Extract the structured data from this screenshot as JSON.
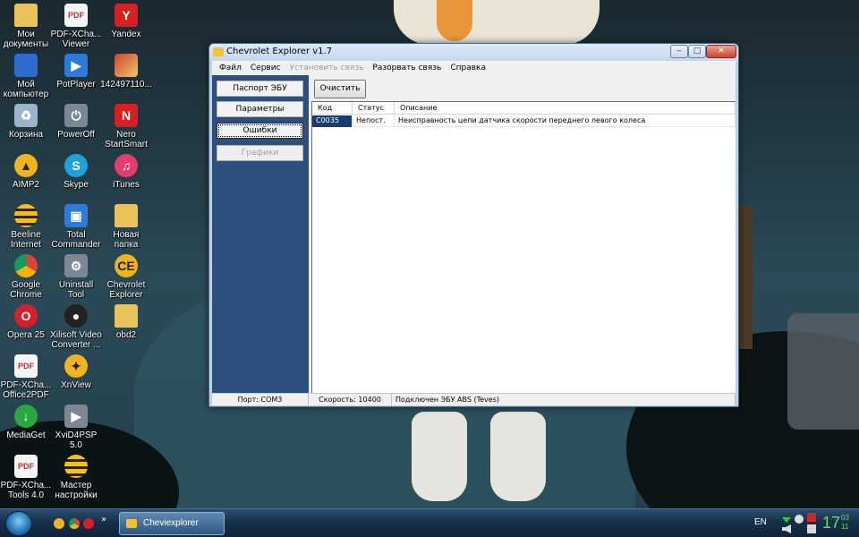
{
  "desktop": {
    "icons": [
      {
        "label": "Мои документы",
        "icon": "folder-icon"
      },
      {
        "label": "Мой компьютер",
        "icon": "computer-icon"
      },
      {
        "label": "Корзина",
        "icon": "recycle-bin-icon"
      },
      {
        "label": "AIMP2",
        "icon": "aimp-icon"
      },
      {
        "label": "Beeline Internet",
        "icon": "beeline-icon"
      },
      {
        "label": "Google Chrome",
        "icon": "chrome-icon"
      },
      {
        "label": "Opera 25",
        "icon": "opera-icon"
      },
      {
        "label": "PDF-XCha... Office2PDF",
        "icon": "pdf-icon"
      },
      {
        "label": "MediaGet",
        "icon": "mediaget-icon"
      },
      {
        "label": "PDF-XCha... Tools 4.0",
        "icon": "pdf-tools-icon"
      },
      {
        "label": "PDF-XCha... Viewer",
        "icon": "pdf-viewer-icon"
      },
      {
        "label": "PotPlayer",
        "icon": "potplayer-icon"
      },
      {
        "label": "PowerOff",
        "icon": "poweroff-icon"
      },
      {
        "label": "Skype",
        "icon": "skype-icon"
      },
      {
        "label": "Total Commander",
        "icon": "total-commander-icon"
      },
      {
        "label": "Uninstall Tool",
        "icon": "uninstall-tool-icon"
      },
      {
        "label": "Xilisoft Video Converter ...",
        "icon": "video-converter-icon"
      },
      {
        "label": "XnView",
        "icon": "xnview-icon"
      },
      {
        "label": "XviD4PSP 5.0",
        "icon": "xvid-icon"
      },
      {
        "label": "Мастер настройки",
        "icon": "beeline-setup-icon"
      },
      {
        "label": "Yandex",
        "icon": "yandex-icon"
      },
      {
        "label": "142497110...",
        "icon": "image-file-icon"
      },
      {
        "label": "Nero StartSmart",
        "icon": "nero-icon"
      },
      {
        "label": "iTunes",
        "icon": "itunes-icon"
      },
      {
        "label": "Новая папка",
        "icon": "folder-icon"
      },
      {
        "label": "Chevrolet Explorer",
        "icon": "chevrolet-explorer-icon"
      },
      {
        "label": "obd2",
        "icon": "folder-icon"
      }
    ]
  },
  "window": {
    "title": "Chevrolet Explorer v1.7",
    "controls": {
      "minimize": "‒",
      "maximize": "□",
      "close": "✕"
    },
    "menu": [
      {
        "label": "Файл",
        "enabled": true
      },
      {
        "label": "Сервис",
        "enabled": true
      },
      {
        "label": "Установить связь",
        "enabled": false
      },
      {
        "label": "Разорвать связь",
        "enabled": true
      },
      {
        "label": "Справка",
        "enabled": true
      }
    ],
    "nav": {
      "pasport": "Паспорт ЭБУ",
      "params": "Параметры",
      "errors": "Ошибки",
      "graphs": "Графики"
    },
    "toolbar": {
      "clear": "Очистить"
    },
    "table": {
      "columns": [
        "Код",
        "Статус",
        "Описание"
      ],
      "rows": [
        {
          "code": "C0035",
          "status": "Непост.",
          "description": "Неисправность цепи датчика скорости переднего левого колеса"
        }
      ]
    },
    "status": {
      "port": "Порт: COM3",
      "speed": "Скорость: 10400",
      "connection": "Подключен ЭБУ ABS (Teves)"
    }
  },
  "taskbar": {
    "more": "»",
    "app_label": "Cheviexplorer",
    "language": "EN",
    "clock_hour": "17",
    "clock_minute": "03",
    "clock_second": "11"
  }
}
